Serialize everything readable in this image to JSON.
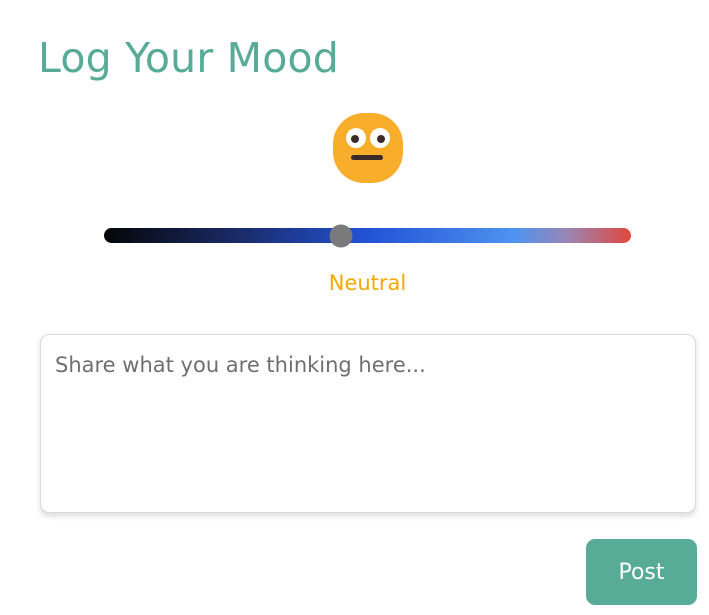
{
  "header": {
    "title": "Log Your Mood"
  },
  "mood": {
    "emoji_icon": "neutral-face-icon",
    "label": "Neutral",
    "slider_value_fraction": 0.45,
    "label_color": "#f2a900"
  },
  "note": {
    "placeholder": "Share what you are thinking here...",
    "value": ""
  },
  "actions": {
    "post_label": "Post"
  },
  "colors": {
    "accent": "#57ab97",
    "thumb": "#7a7a7a",
    "emoji": "#f8ad2b"
  }
}
